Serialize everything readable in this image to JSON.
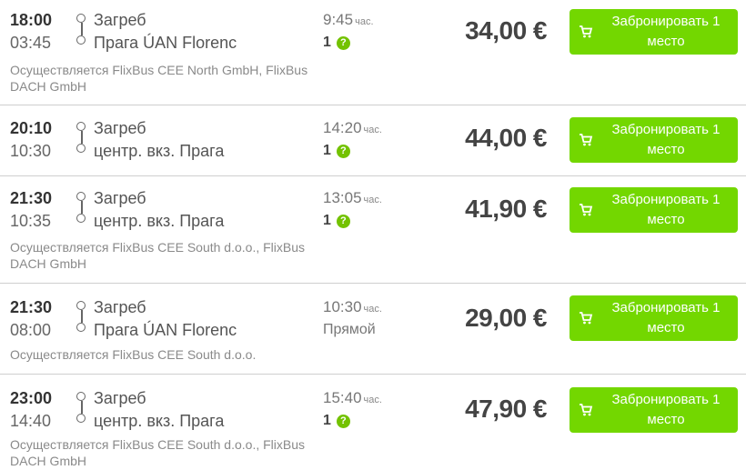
{
  "duration_unit": "час.",
  "book_label": "Забронировать 1 место",
  "colors": {
    "accent": "#73d700",
    "info": "#73c200",
    "divider": "#cfcfcf"
  },
  "icons": {
    "route": "route-line-icon",
    "cart": "cart-icon",
    "info": "question-icon"
  },
  "rides": [
    {
      "dep_time": "18:00",
      "arr_time": "03:45",
      "from": "Загреб",
      "to": "Прага ÚAN Florenc",
      "duration": "9:45",
      "transfers": "1",
      "price": "34,00 €",
      "operator": "Осуществляется FlixBus CEE North GmbH, FlixBus DACH GmbH"
    },
    {
      "dep_time": "20:10",
      "arr_time": "10:30",
      "from": "Загреб",
      "to": "центр. вкз. Прага",
      "duration": "14:20",
      "transfers": "1",
      "price": "44,00 €",
      "operator": ""
    },
    {
      "dep_time": "21:30",
      "arr_time": "10:35",
      "from": "Загреб",
      "to": "центр. вкз. Прага",
      "duration": "13:05",
      "transfers": "1",
      "price": "41,90 €",
      "operator": "Осуществляется FlixBus CEE South d.o.o., FlixBus DACH GmbH"
    },
    {
      "dep_time": "21:30",
      "arr_time": "08:00",
      "from": "Загреб",
      "to": "Прага ÚAN Florenc",
      "duration": "10:30",
      "transfers": "Прямой",
      "price": "29,00 €",
      "operator": "Осуществляется FlixBus CEE South d.o.o."
    },
    {
      "dep_time": "23:00",
      "arr_time": "14:40",
      "from": "Загреб",
      "to": "центр. вкз. Прага",
      "duration": "15:40",
      "transfers": "1",
      "price": "47,90 €",
      "operator": "Осуществляется FlixBus CEE South d.o.o., FlixBus DACH GmbH"
    }
  ]
}
